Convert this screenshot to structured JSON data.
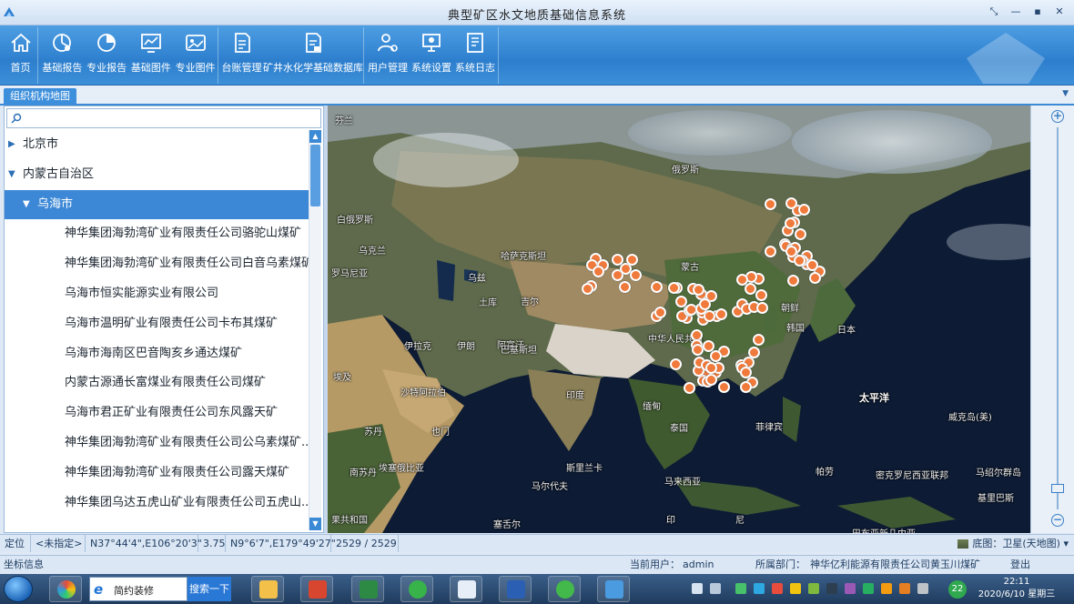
{
  "window": {
    "title": "典型矿区水文地质基础信息系统",
    "controls": [
      "⤡",
      "—",
      "▪",
      "✕"
    ]
  },
  "toolbar": {
    "groups": [
      [
        {
          "label": "首页",
          "icon": "home-icon"
        }
      ],
      [
        {
          "label": "基础报告",
          "icon": "chart-report-icon"
        },
        {
          "label": "专业报告",
          "icon": "pie-report-icon"
        },
        {
          "label": "基础图件",
          "icon": "line-chart-icon"
        },
        {
          "label": "专业图件",
          "icon": "map-image-icon"
        }
      ],
      [
        {
          "label": "台账管理",
          "icon": "ledger-icon"
        },
        {
          "label": "矿井水化学基础数据库",
          "icon": "database-doc-icon"
        }
      ],
      [
        {
          "label": "用户管理",
          "icon": "user-settings-icon"
        },
        {
          "label": "系统设置",
          "icon": "monitor-settings-icon"
        },
        {
          "label": "系统日志",
          "icon": "log-icon"
        }
      ]
    ]
  },
  "tabs": {
    "active": "组织机构地图"
  },
  "tree": {
    "search_placeholder": "",
    "nodes": [
      {
        "label": "北京市",
        "level": 0,
        "expanded": false,
        "selected": false
      },
      {
        "label": "内蒙古自治区",
        "level": 0,
        "expanded": true,
        "selected": false
      },
      {
        "label": "乌海市",
        "level": 1,
        "expanded": true,
        "selected": true
      },
      {
        "label": "神华集团海勃湾矿业有限责任公司骆驼山煤矿",
        "level": 2,
        "selected": false
      },
      {
        "label": "神华集团海勃湾矿业有限责任公司白音乌素煤矿",
        "level": 2,
        "selected": false
      },
      {
        "label": "乌海市恒实能源实业有限公司",
        "level": 2,
        "selected": false
      },
      {
        "label": "乌海市温明矿业有限责任公司卡布其煤矿",
        "level": 2,
        "selected": false
      },
      {
        "label": "乌海市海南区巴音陶亥乡通达煤矿",
        "level": 2,
        "selected": false
      },
      {
        "label": "内蒙古源通长富煤业有限责任公司煤矿",
        "level": 2,
        "selected": false
      },
      {
        "label": "乌海市君正矿业有限责任公司东风露天矿",
        "level": 2,
        "selected": false
      },
      {
        "label": "神华集团海勃湾矿业有限责任公司公乌素煤矿...",
        "level": 2,
        "selected": false
      },
      {
        "label": "神华集团海勃湾矿业有限责任公司露天煤矿",
        "level": 2,
        "selected": false
      },
      {
        "label": "神华集团乌达五虎山矿业有限责任公司五虎山...",
        "level": 2,
        "selected": false
      }
    ]
  },
  "map": {
    "labels": [
      {
        "text": "芬兰",
        "pos": "finland"
      },
      {
        "text": "俄罗斯",
        "pos": "russia"
      },
      {
        "text": "白俄罗斯",
        "pos": "belarus"
      },
      {
        "text": "乌克兰",
        "pos": "ukraine"
      },
      {
        "text": "哈萨克斯坦",
        "pos": "kazakhstan"
      },
      {
        "text": "罗马尼亚",
        "pos": "romania"
      },
      {
        "text": "蒙古",
        "pos": "mongolia"
      },
      {
        "text": "乌兹",
        "pos": "uzbek"
      },
      {
        "text": "土库",
        "pos": "turkmen"
      },
      {
        "text": "吉尔",
        "pos": "kyrgyz"
      },
      {
        "text": "阿富汗",
        "pos": "afghan"
      },
      {
        "text": "伊朗",
        "pos": "iran"
      },
      {
        "text": "伊拉克",
        "pos": "iraq"
      },
      {
        "text": "巴基斯坦",
        "pos": "pakistan"
      },
      {
        "text": "中华人民共和",
        "pos": "china"
      },
      {
        "text": "朝鲜",
        "pos": "nkorea"
      },
      {
        "text": "韩国",
        "pos": "skorea"
      },
      {
        "text": "日本",
        "pos": "japan"
      },
      {
        "text": "印度",
        "pos": "india"
      },
      {
        "text": "缅甸",
        "pos": "myanmar"
      },
      {
        "text": "泰国",
        "pos": "thailand"
      },
      {
        "text": "菲律宾",
        "pos": "philippines"
      },
      {
        "text": "太平洋",
        "pos": "pacific",
        "ocean": true
      },
      {
        "text": "沙特阿拉伯",
        "pos": "saudi"
      },
      {
        "text": "也门",
        "pos": "yemen"
      },
      {
        "text": "埃及",
        "pos": "egypt"
      },
      {
        "text": "苏丹",
        "pos": "sudan"
      },
      {
        "text": "南苏丹",
        "pos": "ssudan"
      },
      {
        "text": "埃塞俄比亚",
        "pos": "ethiopia"
      },
      {
        "text": "斯里兰卡",
        "pos": "srilanka"
      },
      {
        "text": "马尔代夫",
        "pos": "maldives"
      },
      {
        "text": "马来西亚",
        "pos": "malaysia"
      },
      {
        "text": "印",
        "pos": "indo1"
      },
      {
        "text": "尼",
        "pos": "indo2"
      },
      {
        "text": "巴布亚新几内亚",
        "pos": "png"
      },
      {
        "text": "密克罗尼西亚联邦",
        "pos": "micronesia"
      },
      {
        "text": "马绍尔群岛",
        "pos": "marshall"
      },
      {
        "text": "帕劳",
        "pos": "palau"
      },
      {
        "text": "基里巴斯",
        "pos": "kiribati"
      },
      {
        "text": "威克岛(美)",
        "pos": "wake"
      },
      {
        "text": "塞舌尔",
        "pos": "seychelles"
      },
      {
        "text": "果共和国",
        "pos": "congo"
      }
    ],
    "pin_count": 95
  },
  "status": {
    "locate": "定位",
    "unspecified": "<未指定>",
    "coord1": "N37°44'4\",E106°20'3\"",
    "scale": "3.75",
    "coord2": "N9°6'7\",E179°49'27\"",
    "count": "2529 / 2529",
    "basemap": "底图：卫星(天地图)"
  },
  "info": {
    "coord_info": "坐标信息",
    "current_user_label": "当前用户：",
    "current_user": "admin",
    "department_label": "所属部门：",
    "department": "神华亿利能源有限责任公司黄玉川煤矿",
    "logout": "登出"
  },
  "taskbar": {
    "search_value": "简约装修",
    "search_button": "搜索一下",
    "notification_count": "22",
    "time": "22:11",
    "date": "2020/6/10 星期三"
  }
}
